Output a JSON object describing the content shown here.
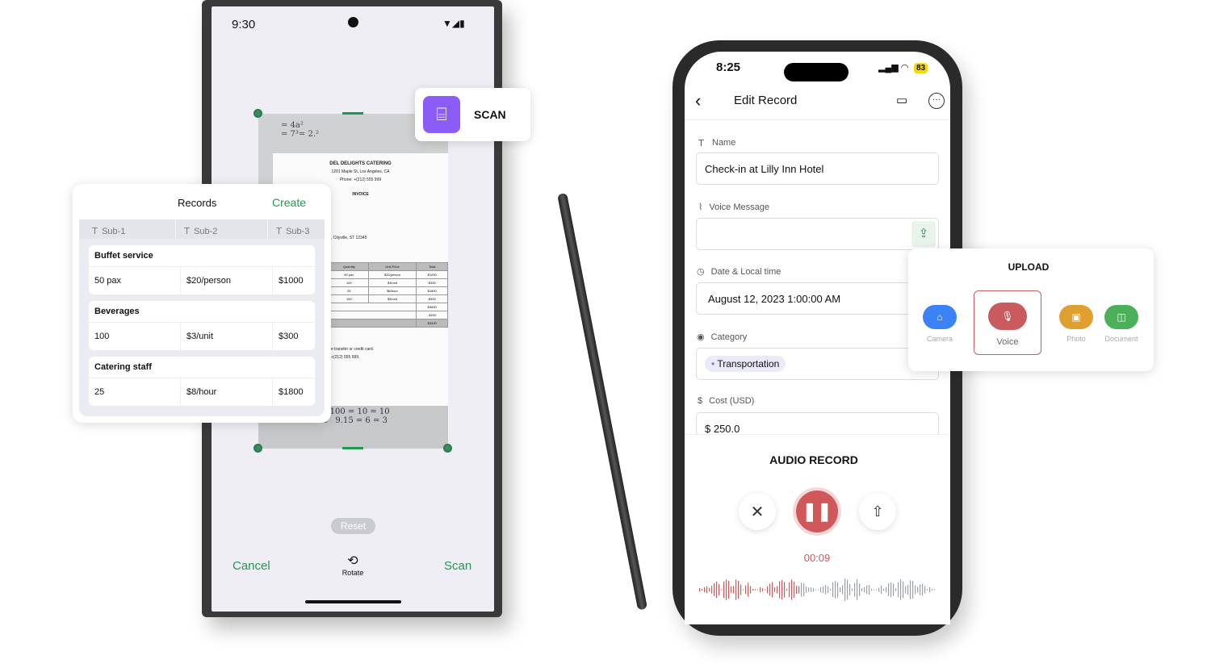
{
  "android": {
    "time": "9:30",
    "cancel": "Cancel",
    "rotate": "Rotate",
    "scan": "Scan",
    "reset": "Reset",
    "scan_badge": "SCAN",
    "accent": "#1e9a4f",
    "invoice": {
      "company": "DEL DELIGHTS CATERING",
      "address": "1201 Maple St, Los Angeles, CA",
      "phone": "Phone: +(212) 555 999",
      "title": "INVOICE",
      "city": ", Cityville, ST 12345",
      "headers": [
        "Quantity",
        "Unit Price",
        "Total"
      ],
      "rows": [
        [
          "50 pax",
          "$20/person",
          "$1000"
        ],
        [
          "100",
          "$3/unit",
          "$300"
        ],
        [
          "25",
          "$8/hour",
          "$1800"
        ],
        [
          "100",
          "$5/unit",
          "$500"
        ]
      ],
      "totals": [
        "$3600",
        "-$200",
        "$3400"
      ],
      "note1": "e transfer or credit card.",
      "note2": "+(212) 555 999."
    }
  },
  "records": {
    "title": "Records",
    "create": "Create",
    "columns": [
      "Sub-1",
      "Sub-2",
      "Sub-3"
    ],
    "groups": [
      {
        "title": "Buffet service",
        "cells": [
          "50 pax",
          "$20/person",
          "$1000"
        ]
      },
      {
        "title": "Beverages",
        "cells": [
          "100",
          "$3/unit",
          "$300"
        ]
      },
      {
        "title": "Catering staff",
        "cells": [
          "25",
          "$8/hour",
          "$1800"
        ]
      }
    ]
  },
  "iphone": {
    "time": "8:25",
    "battery": "83",
    "title": "Edit Record",
    "name_label": "Name",
    "name_value": "Check-in at Lilly Inn Hotel",
    "voice_label": "Voice Message",
    "date_label": "Date & Local time",
    "date_value": "August 12, 2023 1:00:00 AM",
    "category_label": "Category",
    "category_value": "Transportation",
    "cost_label": "Cost (USD)",
    "cost_value": "$ 250.0",
    "audio_title": "AUDIO RECORD",
    "timer": "00:09",
    "record_color": "#d0575a"
  },
  "upload": {
    "title": "UPLOAD",
    "items": [
      {
        "label": "Camera",
        "color": "#3b82f6"
      },
      {
        "label": "Voice",
        "color": "#c95b5e"
      },
      {
        "label": "Photo",
        "color": "#e0a030"
      },
      {
        "label": "Document",
        "color": "#4caf5a"
      }
    ]
  }
}
